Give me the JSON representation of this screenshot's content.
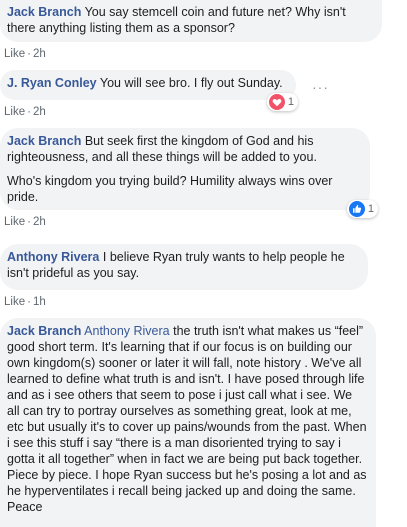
{
  "comments": [
    {
      "author": "Jack Branch",
      "paragraphs": [
        "You say stemcell coin and future net? Why isn't there anything listing them as a sponsor?"
      ],
      "like": "Like",
      "time": "2h"
    },
    {
      "author": "J. Ryan Conley",
      "paragraphs": [
        "You will see bro. I fly out Sunday."
      ],
      "like": "Like",
      "time": "2h",
      "reaction": {
        "icon": "love-icon",
        "count": "1",
        "color": "#f25268"
      },
      "more": "···"
    },
    {
      "author": "Jack Branch",
      "paragraphs": [
        "But seek first the kingdom of God and his righteousness, and all these things will be added to you.",
        "Who's kingdom you trying build? Humility always wins over pride."
      ],
      "like": "Like",
      "time": "2h",
      "reaction": {
        "icon": "like-icon",
        "count": "1",
        "color": "#1877f2"
      }
    },
    {
      "author": "Anthony Rivera",
      "paragraphs": [
        "I believe Ryan truly wants to help people he isn't prideful as you say."
      ],
      "like": "Like",
      "time": "1h"
    },
    {
      "author": "Jack Branch",
      "mention": "Anthony Rivera",
      "paragraphs": [
        "the truth isn't what makes us “feel” good short term. It's learning that if our focus is on building our own kingdom(s) sooner or later it will fall, note history . We've all learned to define what truth is and isn't. I have posed through life and as i see others that seem to pose i just call what i see. We all can try to portray ourselves as something great, look at me, etc but usually it's to cover up pains/wounds from the past. When i see this stuff i say “there is a man disoriented trying to say i gotta it all together” when in fact we are being put back together. Piece by piece. I hope Ryan success but he's posing a lot and as he hyperventilates i recall being jacked up and doing the same. Peace"
      ]
    }
  ]
}
